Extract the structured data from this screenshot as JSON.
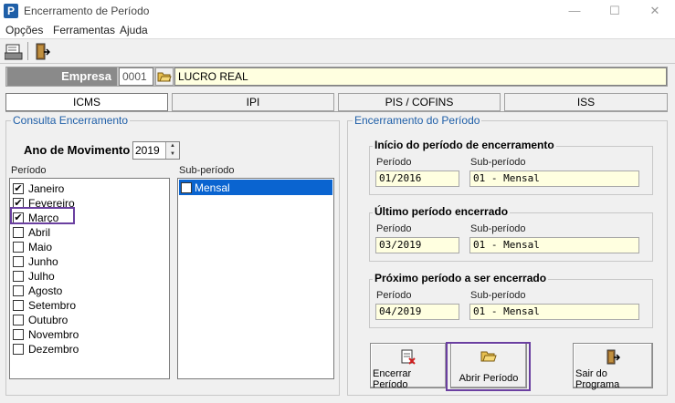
{
  "window": {
    "title": "Encerramento de Período",
    "app_icon_letter": "P"
  },
  "controls": {
    "minimize": "—",
    "maximize": "☐",
    "close": "✕"
  },
  "menu": [
    "Opções",
    "Ferramentas",
    "Ajuda"
  ],
  "empresa": {
    "label": "Empresa",
    "code": "0001",
    "name": "LUCRO REAL"
  },
  "tabs": [
    "ICMS",
    "IPI",
    "PIS / COFINS",
    "ISS"
  ],
  "consulta": {
    "title": "Consulta Encerramento",
    "ano_label": "Ano de Movimento",
    "ano": "2019",
    "periodo_label": "Período",
    "subperiodo_label": "Sub-período",
    "months": [
      {
        "label": "Janeiro",
        "checked": true
      },
      {
        "label": "Fevereiro",
        "checked": true
      },
      {
        "label": "Março",
        "checked": true
      },
      {
        "label": "Abril",
        "checked": false
      },
      {
        "label": "Maio",
        "checked": false
      },
      {
        "label": "Junho",
        "checked": false
      },
      {
        "label": "Julho",
        "checked": false
      },
      {
        "label": "Agosto",
        "checked": false
      },
      {
        "label": "Setembro",
        "checked": false
      },
      {
        "label": "Outubro",
        "checked": false
      },
      {
        "label": "Novembro",
        "checked": false
      },
      {
        "label": "Dezembro",
        "checked": false
      }
    ],
    "subperiods": [
      {
        "label": "Mensal",
        "checked": false,
        "selected": true
      }
    ]
  },
  "encerramento": {
    "title": "Encerramento do Período",
    "inicio": {
      "title": "Início do período de encerramento",
      "periodo_label": "Período",
      "sub_label": "Sub-período",
      "periodo": "01/2016",
      "sub": "01 - Mensal"
    },
    "ultimo": {
      "title": "Último período encerrado",
      "periodo_label": "Período",
      "sub_label": "Sub-período",
      "periodo": "03/2019",
      "sub": "01 - Mensal"
    },
    "proximo": {
      "title": "Próximo período a ser encerrado",
      "periodo_label": "Período",
      "sub_label": "Sub-período",
      "periodo": "04/2019",
      "sub": "01 - Mensal"
    }
  },
  "buttons": {
    "encerrar": "Encerrar Período",
    "abrir": "Abrir Período",
    "sair": "Sair do Programa"
  },
  "colors": {
    "accent": "#1f5fa8",
    "highlight": "#6a3fa0",
    "readonly_bg": "#ffffe0",
    "selection": "#0a64d0"
  }
}
